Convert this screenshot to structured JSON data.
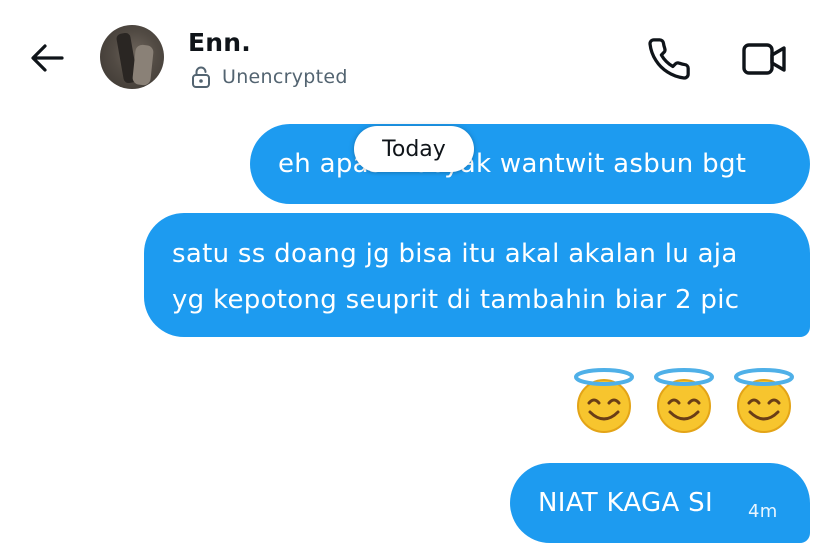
{
  "header": {
    "contact_name": "Enn.",
    "encryption_status": "Unencrypted",
    "icons": {
      "back": "arrow-left-icon",
      "lock": "unlocked-lock-icon",
      "call": "phone-icon",
      "video": "video-camera-icon"
    }
  },
  "conversation": {
    "date_divider": "Today",
    "messages": [
      {
        "type": "text",
        "lines": [
          "eh apasi kocyak wantwit asbun bgt"
        ]
      },
      {
        "type": "text",
        "lines": [
          "satu ss doang jg bisa itu akal akalan lu aja",
          "yg kepotong seuprit di tambahin biar 2 pic"
        ]
      },
      {
        "type": "emoji",
        "emoji": "😇😇😇",
        "icon": "smiling-face-with-halo-icon"
      },
      {
        "type": "text",
        "lines": [
          "NIAT KAGA SI"
        ],
        "time": "4m"
      }
    ]
  },
  "colors": {
    "bubble": "#1d9bf0",
    "bubble_text": "#ffffff",
    "secondary_text": "#536471",
    "primary_text": "#0f1419"
  }
}
